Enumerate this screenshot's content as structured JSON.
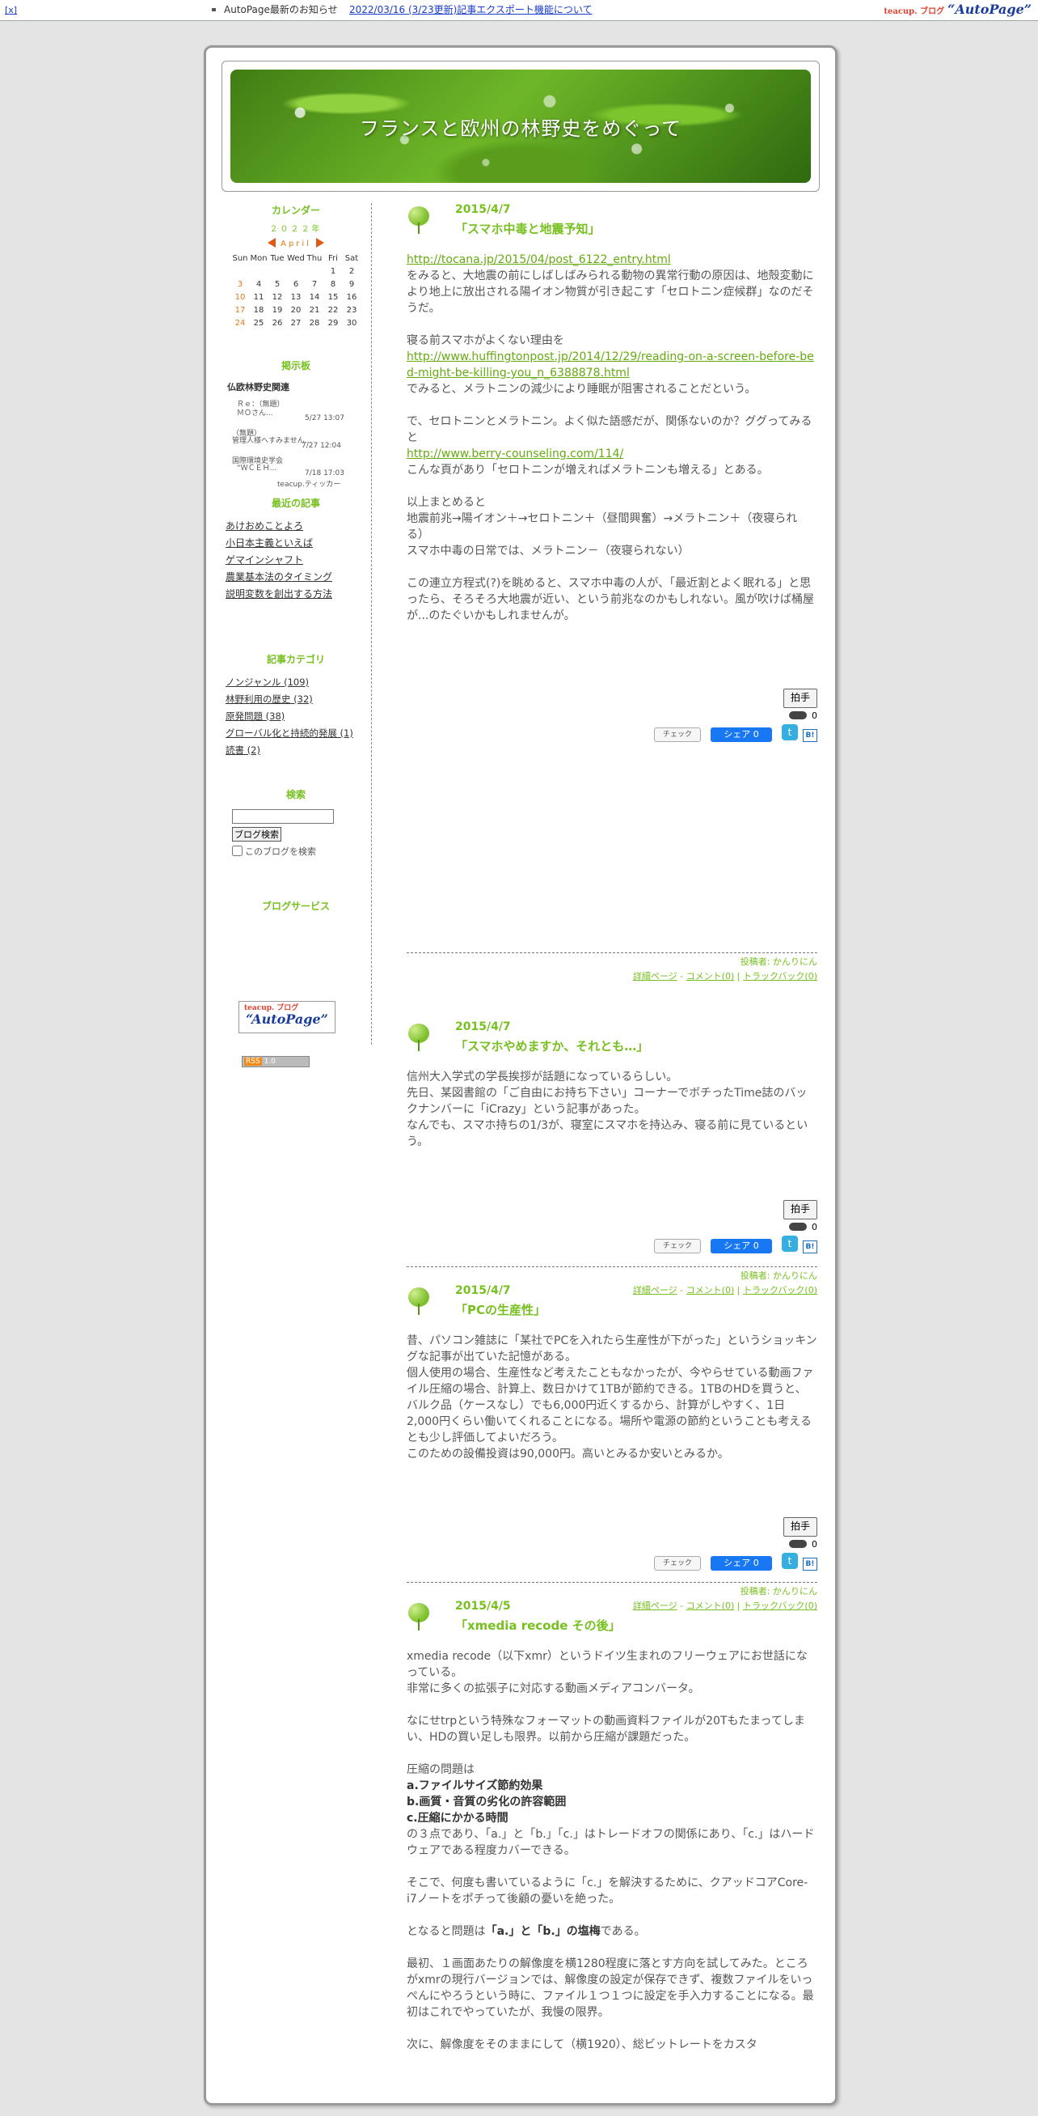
{
  "topbar": {
    "close": "[x]",
    "notice": "AutoPage最新のお知らせ",
    "notice_link": "2022/03/16 (3/23更新)記事エクスポート機能について",
    "brand_small": "teacup. ブログ",
    "brand": "“AutoPage”"
  },
  "blog": {
    "title": "フランスと欧州の林野史をめぐって"
  },
  "sidebar": {
    "calendar_title": "カレンダー",
    "year": "２０２２年",
    "month": "April",
    "weekdays": [
      "Sun",
      "Mon",
      "Tue",
      "Wed",
      "Thu",
      "Fri",
      "Sat"
    ],
    "weeks": [
      [
        "",
        "",
        "",
        "",
        "",
        "1",
        "2"
      ],
      [
        "3",
        "4",
        "5",
        "6",
        "7",
        "8",
        "9"
      ],
      [
        "10",
        "11",
        "12",
        "13",
        "14",
        "15",
        "16"
      ],
      [
        "17",
        "18",
        "19",
        "20",
        "21",
        "22",
        "23"
      ],
      [
        "24",
        "25",
        "26",
        "27",
        "28",
        "29",
        "30"
      ]
    ],
    "bbs_title": "掲示板",
    "bbs_name": "仏欧林野史関連",
    "bbs_entries": [
      {
        "text": "Ｒｅ：（無題）",
        "date": ""
      },
      {
        "text": "ＭＯさん...",
        "date": "5/27 13:07"
      },
      {
        "text": "（無題）",
        "date": ""
      },
      {
        "text": "管理人様へすみません...",
        "date": "7/27 12:04"
      },
      {
        "text": "国際環境史学会",
        "date": ""
      },
      {
        "text": "“ＷＣＥＨ...",
        "date": "7/18 17:03"
      }
    ],
    "bbs_footer": "teacup.ティッカー",
    "recent_title": "最近の記事",
    "recent": [
      "あけおめことよろ",
      "小日本主義といえば",
      "ゲマインシャフト",
      "農業基本法のタイミング",
      "説明変数を創出する方法"
    ],
    "category_title": "記事カテゴリ",
    "categories": [
      "ノンジャンル (109)",
      "林野利用の歴史 (32)",
      "原発問題 (38)",
      "グローバル化と持続的発展 (1)",
      "読書 (2)"
    ],
    "search_title": "検索",
    "search_button": "ブログ検索",
    "search_checkbox": "このブログを検索",
    "service_title": "ブログサービス",
    "ap_small": "teacup. ブログ",
    "ap_badge": "“AutoPage”",
    "rss_label": "RSS",
    "rss_version": "1.0"
  },
  "common": {
    "clap": "拍手",
    "clap_count": "0",
    "check": "チェック",
    "fb_share": "シェア 0",
    "hatena": "B!",
    "author": "投稿者: かんりにん",
    "detail": "詳細ページ",
    "sep": "-",
    "comment": "コメント(0)",
    "pipe": "|",
    "trackback": "トラックバック(0)"
  },
  "posts": [
    {
      "date": "2015/4/7",
      "title": "「スマホ中毒と地震予知」",
      "p1_link": "http://tocana.jp/2015/04/post_6122_entry.html",
      "p1_text": "をみると、大地震の前にしばしばみられる動物の異常行動の原因は、地殻変動により地上に放出される陽イオン物質が引き起こす「セロトニン症候群」なのだそうだ。",
      "p2_text1": "寝る前スマホがよくない理由を",
      "p2_link": "http://www.huffingtonpost.jp/2014/12/29/reading-on-a-screen-before-bed-might-be-killing-you_n_6388878.html",
      "p2_text2": "でみると、メラトニンの減少により睡眠が阻害されることだという。",
      "p3_text1": "で、セロトニンとメラトニン。よく似た語感だが、関係ないのか？ググってみると",
      "p3_link": "http://www.berry-counseling.com/114/",
      "p3_text2": "こんな頁があり「セロトニンが増えればメラトニンも増える」とある。",
      "p4_l1": "以上まとめると",
      "p4_l2": "地震前兆→陽イオン＋→セロトニン＋（昼間興奮）→メラトニン＋（夜寝られる）",
      "p4_l3": "スマホ中毒の日常では、メラトニン－（夜寝られない）",
      "p5": "この連立方程式(?)を眺めると、スマホ中毒の人が、「最近割とよく眠れる」と思ったら、そろそろ大地震が近い、という前兆なのかもしれない。風が吹けば桶屋が...のたぐいかもしれませんが。"
    },
    {
      "date": "2015/4/7",
      "title": "「スマホやめますか、それとも…」",
      "l1": "信州大入学式の学長挨拶が話題になっているらしい。",
      "l2": "先日、某図書館の「ご自由にお持ち下さい」コーナーでボチったTime誌のバックナンバーに「iCrazy」という記事があった。",
      "l3": "なんでも、スマホ持ちの1/3が、寝室にスマホを持込み、寝る前に見ているという。"
    },
    {
      "date": "2015/4/7",
      "title": "「PCの生産性」",
      "l1": "昔、パソコン雑誌に「某社でPCを入れたら生産性が下がった」というショッキングな記事が出ていた記憶がある。",
      "l2": "個人使用の場合、生産性など考えたこともなかったが、今やらせている動画ファイル圧縮の場合、計算上、数日かけて1TBが節約できる。1TBのHDを買うと、バルク品（ケースなし）でも6,000円近くするから、計算がしやすく、1日2,000円くらい働いてくれることになる。場所や電源の節約ということも考えるとも少し評価してよいだろう。",
      "l3": "このための設備投資は90,000円。高いとみるか安いとみるか。"
    },
    {
      "date": "2015/4/5",
      "title": "「xmedia recode その後」",
      "p1_l1": "xmedia recode（以下xmr）というドイツ生まれのフリーウェアにお世話になっている。",
      "p1_l2": "非常に多くの拡張子に対応する動画メディアコンバータ。",
      "p2": "なにせtrpという特殊なフォーマットの動画資料ファイルが20Tもたまってしまい、HDの買い足しも限界。以前から圧縮が課題だった。",
      "p3_l1": "圧縮の問題は",
      "p3_a": "a.ファイルサイズ節約効果",
      "p3_b": "b.画質・音質の劣化の許容範囲",
      "p3_c": "c.圧縮にかかる時間",
      "p3_tail": "の３点であり、「a.」と「b.」「c.」はトレードオフの関係にあり、「c.」はハードウェアである程度カバーできる。",
      "p4": "そこで、何度も書いているように「c.」を解決するために、クアッドコアCore-i7ノートをポチって後顧の憂いを絶った。",
      "p5_pre": "となると問題は",
      "p5_bold": "「a.」と「b.」の塩梅",
      "p5_post": "である。",
      "p6": "最初、１画面あたりの解像度を横1280程度に落とす方向を試してみた。ところがxmrの現行バージョンでは、解像度の設定が保存できず、複数ファイルをいっぺんにやろうという時に、ファイル１つ１つに設定を手入力することになる。最初はこれでやっていたが、我慢の限界。",
      "p7": "次に、解像度をそのままにして（横1920）、総ビットレートをカスタ"
    }
  ]
}
